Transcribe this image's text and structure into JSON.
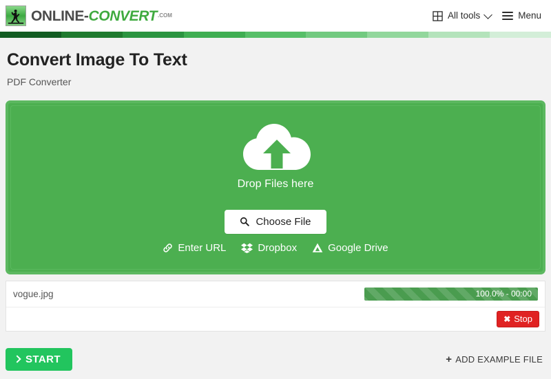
{
  "header": {
    "brand": {
      "logo_icon": "running-man-logo-icon",
      "text_dark": "ONLINE-",
      "text_green": "CONVERT",
      "text_tld": ".COM"
    },
    "nav": {
      "all_tools_icon": "grid-icon",
      "all_tools_label": "All tools",
      "chevron_icon": "chevron-down-icon",
      "burger_icon": "hamburger-menu-icon",
      "menu_label": "Menu"
    }
  },
  "gradient_bar": {
    "colors": [
      "#125c22",
      "#1f7a2e",
      "#2b9440",
      "#3fae52",
      "#57bf68",
      "#72ca80",
      "#92d79c",
      "#b4e3bb",
      "#d3eed8"
    ]
  },
  "page": {
    "title": "Convert Image To Text",
    "subtitle": "PDF Converter"
  },
  "dropzone": {
    "cloud_icon": "cloud-upload-icon",
    "drop_text": "Drop Files here",
    "choose_file": {
      "icon": "search-icon",
      "label": "Choose File"
    },
    "sources": [
      {
        "icon": "link-icon",
        "label": "Enter URL"
      },
      {
        "icon": "dropbox-icon",
        "label": "Dropbox"
      },
      {
        "icon": "google-drive-icon",
        "label": "Google Drive"
      }
    ],
    "background_color": "#4caf50"
  },
  "file_list": {
    "rows": [
      {
        "name": "vogue.jpg",
        "progress_percent": 100,
        "progress_label": "100.0% - 00:00"
      }
    ],
    "stop_button": {
      "icon": "close-icon",
      "label": "Stop",
      "color": "#e02222"
    }
  },
  "footer": {
    "start_button": {
      "icon": "chevron-right-icon",
      "label": "START",
      "color": "#22c55e"
    },
    "example_button": {
      "icon": "plus-icon",
      "label": "ADD EXAMPLE FILE"
    }
  }
}
